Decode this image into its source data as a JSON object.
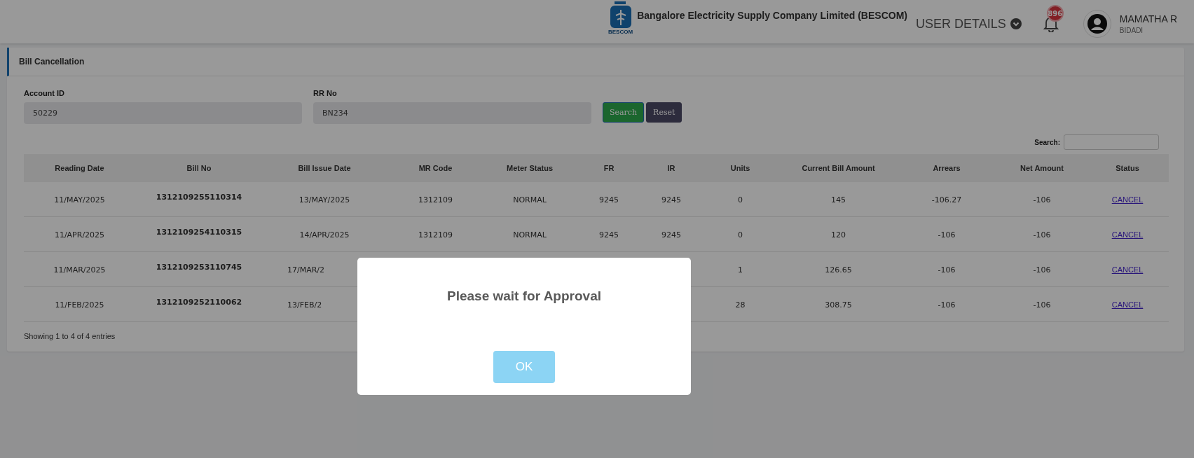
{
  "header": {
    "logo_caption": "BESCOM",
    "company": "Bangalore Electricity Supply Company Limited (BESCOM)",
    "user_details": "USER DETAILS",
    "notification_count": "896",
    "user_name": "MAMATHA R",
    "user_location": "BIDADI"
  },
  "panel": {
    "title": "Bill Cancellation"
  },
  "form": {
    "fields": [
      {
        "label": "Account ID",
        "value": "50229"
      },
      {
        "label": "RR No",
        "value": "BN234"
      }
    ],
    "buttons": [
      {
        "label": "Search",
        "kind": "primary"
      },
      {
        "label": "Reset",
        "kind": "secondary"
      }
    ]
  },
  "table": {
    "search_label": "Search:",
    "columns": [
      "Reading Date",
      "Bill No",
      "Bill Issue Date",
      "MR Code",
      "Meter Status",
      "FR",
      "IR",
      "Units",
      "Current Bill Amount",
      "Arrears",
      "Net Amount",
      "Status"
    ],
    "rows": [
      {
        "cells": [
          "11/MAY/2025",
          "1312109255110314",
          "13/MAY/2025",
          "1312109",
          "NORMAL",
          "9245",
          "9245",
          "0",
          "145",
          "-106.27",
          "-106",
          "CANCEL"
        ]
      },
      {
        "cells": [
          "11/APR/2025",
          "1312109254110315",
          "14/APR/2025",
          "1312109",
          "NORMAL",
          "9245",
          "9245",
          "0",
          "120",
          "-106",
          "-106",
          "CANCEL"
        ]
      },
      {
        "cells": [
          "11/MAR/2025",
          "1312109253110745",
          "17/MAR/2",
          null,
          null,
          null,
          null,
          "1",
          "126.65",
          "-106",
          "-106",
          "CANCEL"
        ]
      },
      {
        "cells": [
          "11/FEB/2025",
          "1312109252110062",
          "13/FEB/2",
          null,
          null,
          null,
          null,
          "28",
          "308.75",
          "-106",
          "-106",
          "CANCEL"
        ]
      }
    ],
    "footer": "Showing 1 to 4 of 4 entries"
  },
  "dialog": {
    "message": "Please wait for Approval",
    "button": "OK"
  }
}
